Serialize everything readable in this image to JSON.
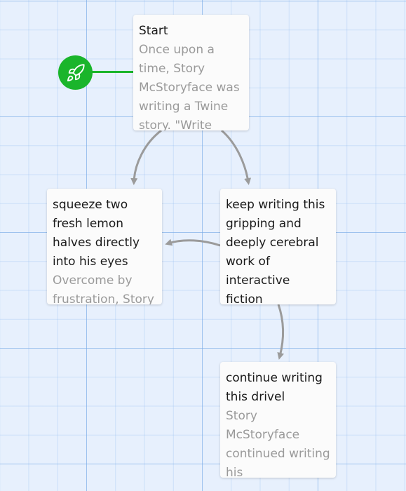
{
  "story_map": {
    "start_marker": {
      "icon": "rocket-icon",
      "color": "#1ab52b"
    },
    "passages": [
      {
        "name": "Start",
        "excerpt": "Once upon a time, Story McStoryface was writing a Twine story. \"Write"
      },
      {
        "name": "squeeze two fresh lemon halves directly into his eyes",
        "excerpt": "Overcome by frustration, Story"
      },
      {
        "name": "keep writing this gripping and deeply cerebral work of interactive fiction",
        "excerpt": ""
      },
      {
        "name": "continue writing this drivel",
        "excerpt": "Story McStoryface continued writing his"
      }
    ],
    "link_color": "#9b9b9b",
    "grid_color": "#e7f0fd"
  }
}
